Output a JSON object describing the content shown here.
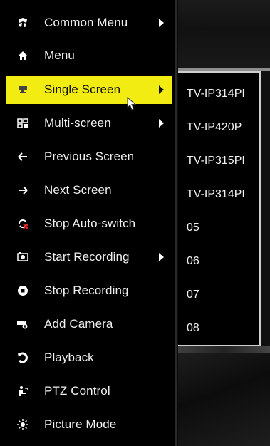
{
  "menu": {
    "items": [
      {
        "label": "Common Menu",
        "icon": "grid-star-icon",
        "has_submenu": true,
        "active": false
      },
      {
        "label": "Menu",
        "icon": "home-icon",
        "has_submenu": false,
        "active": false
      },
      {
        "label": "Single Screen",
        "icon": "single-screen-icon",
        "has_submenu": true,
        "active": true
      },
      {
        "label": "Multi-screen",
        "icon": "multi-screen-icon",
        "has_submenu": true,
        "active": false
      },
      {
        "label": "Previous Screen",
        "icon": "arrow-left-icon",
        "has_submenu": false,
        "active": false
      },
      {
        "label": "Next Screen",
        "icon": "arrow-right-icon",
        "has_submenu": false,
        "active": false
      },
      {
        "label": "Stop Auto-switch",
        "icon": "stop-switch-icon",
        "has_submenu": false,
        "active": false
      },
      {
        "label": "Start Recording",
        "icon": "record-icon",
        "has_submenu": true,
        "active": false
      },
      {
        "label": "Stop Recording",
        "icon": "stop-record-icon",
        "has_submenu": false,
        "active": false
      },
      {
        "label": "Add Camera",
        "icon": "add-camera-icon",
        "has_submenu": false,
        "active": false
      },
      {
        "label": "Playback",
        "icon": "playback-icon",
        "has_submenu": false,
        "active": false
      },
      {
        "label": "PTZ Control",
        "icon": "ptz-icon",
        "has_submenu": false,
        "active": false
      },
      {
        "label": "Picture Mode",
        "icon": "picture-mode-icon",
        "has_submenu": false,
        "active": false
      }
    ]
  },
  "submenu": {
    "items": [
      "TV-IP314PI",
      "TV-IP420P",
      "TV-IP315PI",
      "TV-IP314PI",
      "05",
      "06",
      "07",
      "08"
    ]
  },
  "colors": {
    "highlight": "#f2ec12",
    "background": "#000000",
    "text": "#f0f0f0"
  }
}
